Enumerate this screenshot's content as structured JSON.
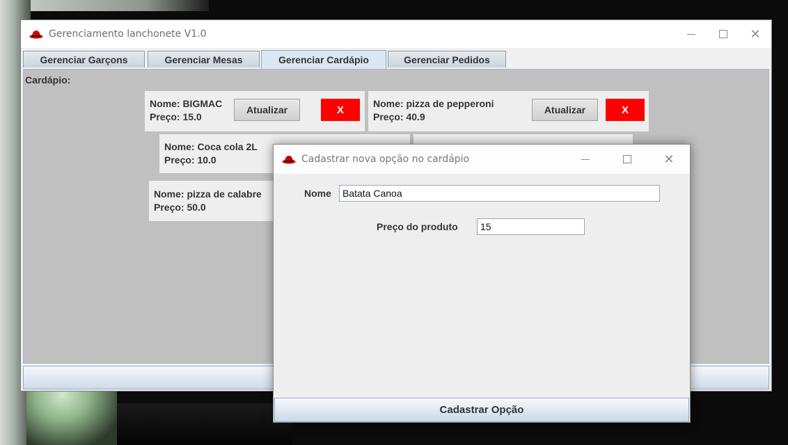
{
  "main_window": {
    "title": "Gerenciamento lanchonete V1.0",
    "tabs": [
      {
        "label": "Gerenciar Garçons"
      },
      {
        "label": "Gerenciar Mesas"
      },
      {
        "label": "Gerenciar Cardápio",
        "active": true
      },
      {
        "label": "Gerenciar Pedidos"
      }
    ],
    "content_label": "Cardápio:",
    "menu_items": [
      {
        "name": "Nome: BIGMAC",
        "price": "Preço: 15.0"
      },
      {
        "name": "Nome: pizza de pepperoni",
        "price": "Preço: 40.9"
      },
      {
        "name": "Nome: Coca cola 2L",
        "price": "Preço: 10.0"
      },
      {
        "name": "Nome: pizza de calabre",
        "price": "Preço: 50.0"
      }
    ],
    "update_label": "Atualizar",
    "delete_label": "X"
  },
  "dialog": {
    "title": "Cadastrar nova opção no cardápio",
    "name_label": "Nome",
    "name_value": "Batata Canoa",
    "price_label": "Preço do produto",
    "price_value": "15",
    "submit_label": "Cadastrar Opção"
  },
  "colors": {
    "delete_button": "#ff0000",
    "content_background": "#c0c0c0",
    "app_icon": "#cc0000"
  },
  "icons": {
    "app_icon": "red-hat-icon",
    "minimize": "minimize-icon",
    "maximize": "maximize-icon",
    "close": "close-icon"
  }
}
